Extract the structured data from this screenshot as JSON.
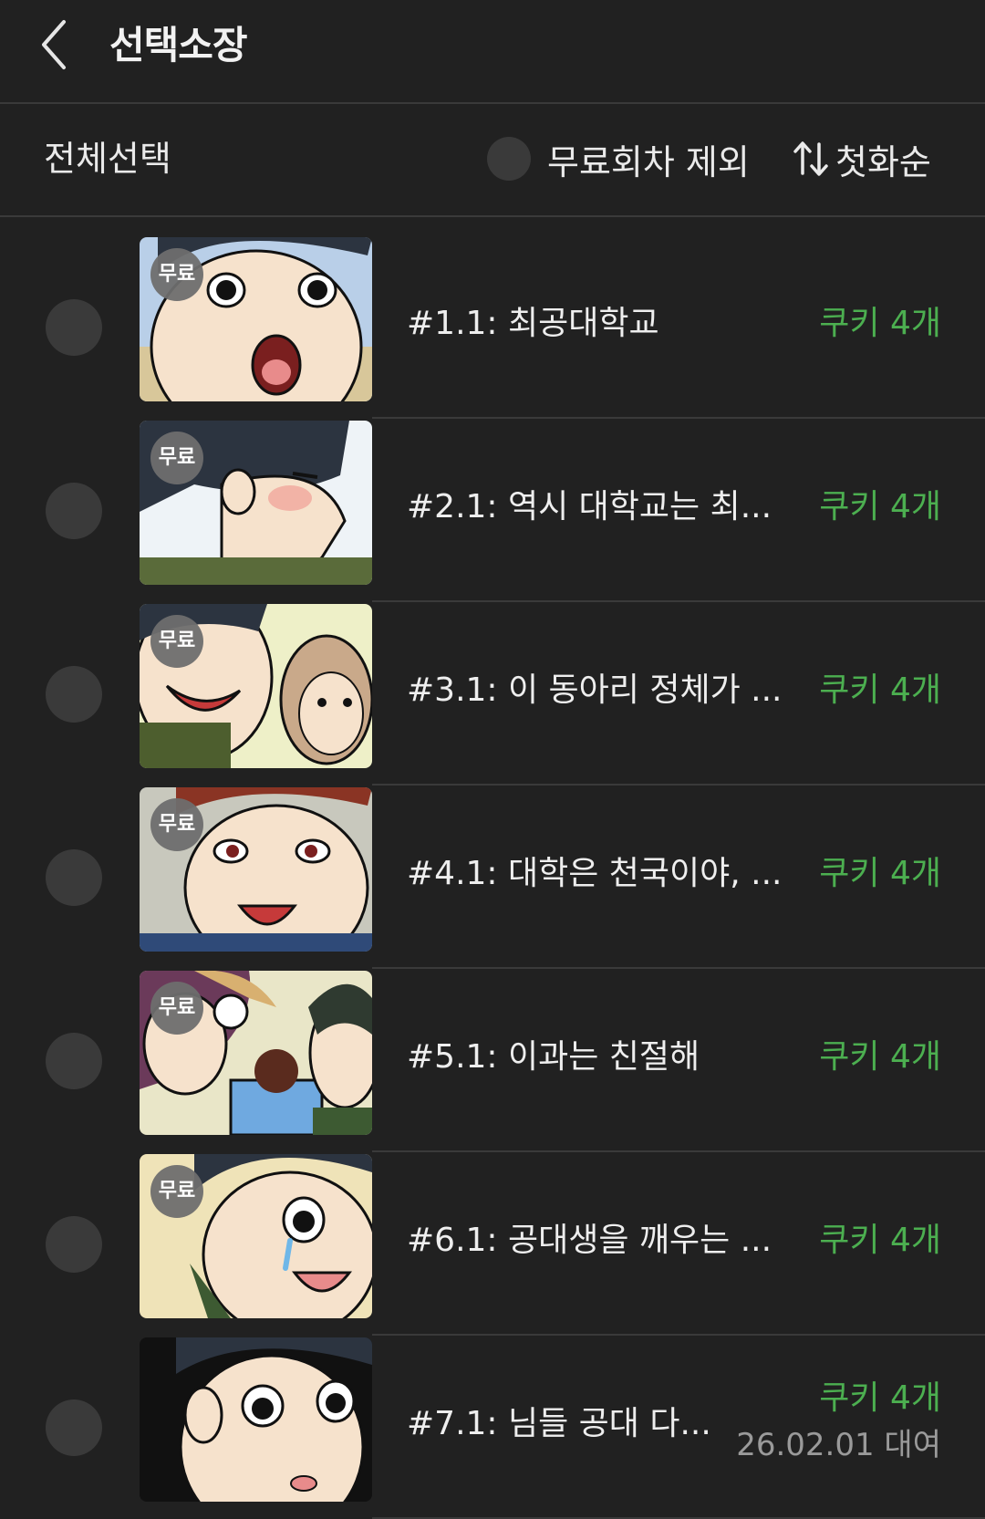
{
  "header": {
    "title": "선택소장",
    "back_icon": "chevron-left-icon"
  },
  "toolbar": {
    "select_all_label": "전체선택",
    "exclude_free_label": "무료회차 제외",
    "sort_label": "첫화순",
    "sort_icon": "sort-arrows-icon"
  },
  "colors": {
    "background": "#212121",
    "divider": "#3a3a3a",
    "accent_green": "#4caf50",
    "muted_text": "#9a9a9a"
  },
  "episodes": [
    {
      "title": "#1.1: 최공대학교",
      "badge": "무료",
      "price": "쿠키 4개",
      "rental": ""
    },
    {
      "title": "#2.1: 역시 대학교는 최...",
      "badge": "무료",
      "price": "쿠키 4개",
      "rental": ""
    },
    {
      "title": "#3.1: 이 동아리 정체가 ...",
      "badge": "무료",
      "price": "쿠키 4개",
      "rental": ""
    },
    {
      "title": "#4.1: 대학은 천국이야, ...",
      "badge": "무료",
      "price": "쿠키 4개",
      "rental": ""
    },
    {
      "title": "#5.1: 이과는 친절해",
      "badge": "무료",
      "price": "쿠키 4개",
      "rental": ""
    },
    {
      "title": "#6.1: 공대생을 깨우는 ...",
      "badge": "무료",
      "price": "쿠키 4개",
      "rental": ""
    },
    {
      "title": "#7.1: 님들 공대 다...",
      "badge": "",
      "price": "쿠키 4개",
      "rental": "26.02.01 대여"
    }
  ]
}
